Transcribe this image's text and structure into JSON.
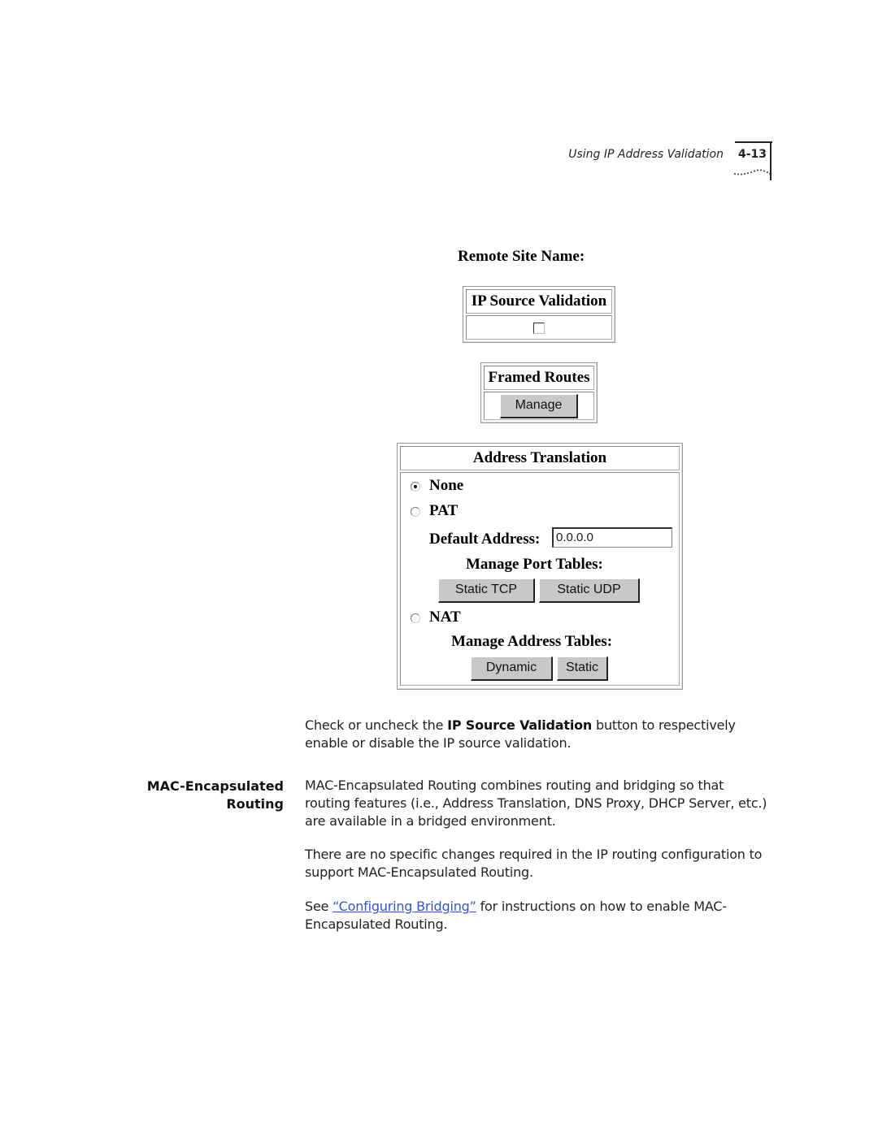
{
  "header": {
    "section_title": "Using IP Address Validation",
    "page_number": "4-13"
  },
  "form": {
    "remote_site_label": "Remote Site Name:",
    "ip_source_validation": {
      "title": "IP Source Validation",
      "checked": false
    },
    "framed_routes": {
      "title": "Framed Routes",
      "manage_button": "Manage"
    },
    "address_translation": {
      "title": "Address Translation",
      "options": [
        {
          "label": "None",
          "selected": true
        },
        {
          "label": "PAT",
          "selected": false
        },
        {
          "label": "NAT",
          "selected": false
        }
      ],
      "default_address_label": "Default Address:",
      "default_address_value": "0.0.0.0",
      "port_tables_label": "Manage Port Tables:",
      "static_tcp_button": "Static TCP",
      "static_udp_button": "Static UDP",
      "address_tables_label": "Manage Address Tables:",
      "dynamic_button": "Dynamic",
      "static_button": "Static"
    }
  },
  "body": {
    "para1_pre": "Check or uncheck the ",
    "para1_bold": "IP Source Validation",
    "para1_post": " button to respectively enable or disable the IP source validation.",
    "side_heading_line1": "MAC-Encapsulated",
    "side_heading_line2": "Routing",
    "para2": "MAC-Encapsulated Routing combines routing and bridging so that routing features (i.e., Address Translation, DNS Proxy, DHCP Server, etc.) are available in a bridged environment.",
    "para3": "There are no specific changes required in the IP routing configuration to support MAC-Encapsulated Routing.",
    "para4_pre": "See ",
    "para4_link": "“Configuring Bridging”",
    "para4_post": " for instructions on how to enable MAC-Encapsulated Routing."
  }
}
